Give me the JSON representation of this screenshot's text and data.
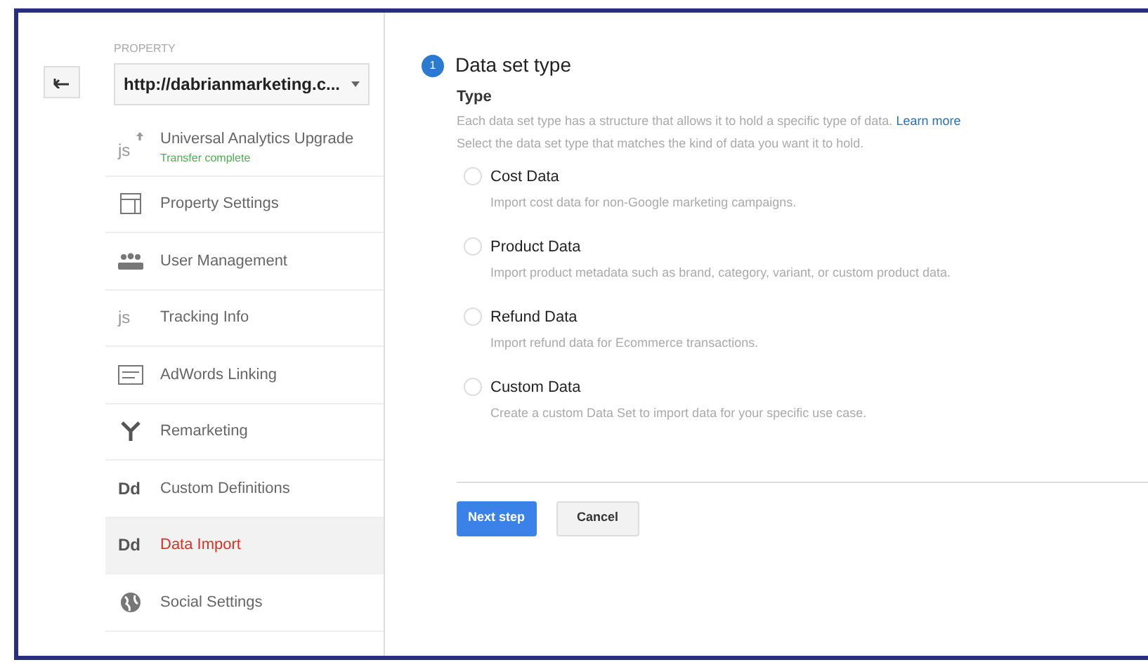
{
  "property": {
    "label": "PROPERTY",
    "value": "http://dabrianmarketing.c..."
  },
  "sidebar": {
    "items": [
      {
        "kind": "upgrade",
        "icon_text": "js",
        "label": "Universal Analytics Upgrade",
        "sublabel": "Transfer complete",
        "selected": false
      },
      {
        "kind": "panel",
        "label": "Property Settings",
        "selected": false
      },
      {
        "kind": "people",
        "label": "User Management",
        "selected": false
      },
      {
        "kind": "text",
        "icon_text": "js",
        "label": "Tracking Info",
        "selected": false
      },
      {
        "kind": "list",
        "label": "AdWords Linking",
        "selected": false
      },
      {
        "kind": "fork",
        "label": "Remarketing",
        "selected": false
      },
      {
        "kind": "text",
        "icon_text": "Dd",
        "label": "Custom Definitions",
        "selected": false
      },
      {
        "kind": "text",
        "icon_text": "Dd",
        "label": "Data Import",
        "selected": true
      },
      {
        "kind": "globe",
        "label": "Social Settings",
        "selected": false
      }
    ]
  },
  "step": {
    "number": "1",
    "title": "Data set type",
    "section": "Type",
    "description": "Each data set type has a structure that allows it to hold a specific type of data.",
    "link": "Learn more",
    "description2": "Select the data set type that matches the kind of data you want it to hold.",
    "options": [
      {
        "label": "Cost Data",
        "description": "Import cost data for non-Google marketing campaigns.",
        "selected": false
      },
      {
        "label": "Product Data",
        "description": "Import product metadata such as brand, category, variant, or custom product data.",
        "selected": false
      },
      {
        "label": "Refund Data",
        "description": "Import refund data for Ecommerce transactions.",
        "selected": false
      },
      {
        "label": "Custom Data",
        "description": "Create a custom Data Set to import data for your specific use case.",
        "selected": false
      }
    ]
  },
  "buttons": {
    "primary": "Next step",
    "secondary": "Cancel"
  }
}
